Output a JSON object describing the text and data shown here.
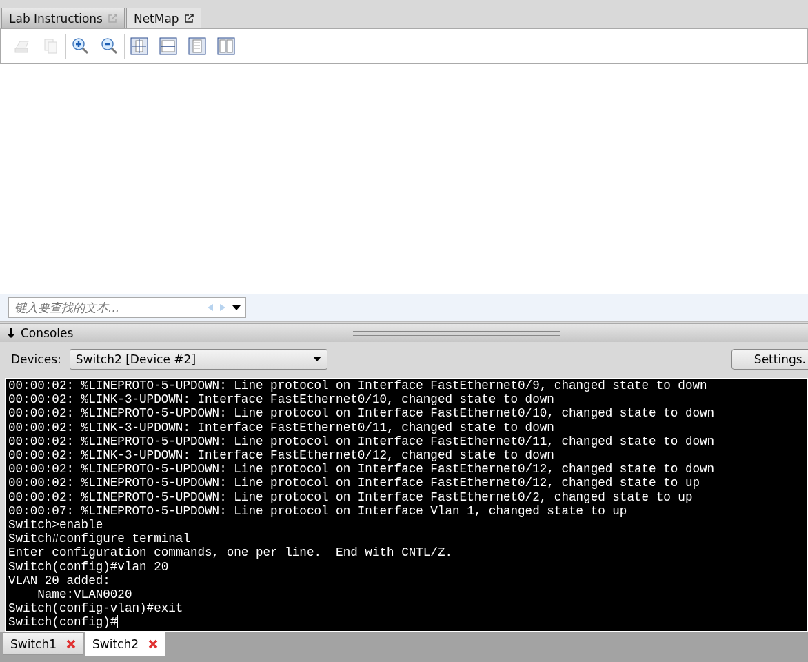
{
  "top_tabs": [
    {
      "label": "Lab Instructions",
      "selected": false
    },
    {
      "label": "NetMap",
      "selected": true
    }
  ],
  "toolbar": {
    "groups": [
      [
        {
          "kind": "print",
          "disabled": true
        },
        {
          "kind": "copy",
          "disabled": true
        }
      ],
      [
        {
          "kind": "zoom-in",
          "disabled": false
        },
        {
          "kind": "zoom-out",
          "disabled": false
        }
      ],
      [
        {
          "kind": "fit-page",
          "disabled": false
        },
        {
          "kind": "fit-width",
          "disabled": false
        },
        {
          "kind": "single-page",
          "disabled": false
        },
        {
          "kind": "two-page",
          "disabled": false
        }
      ]
    ]
  },
  "find": {
    "placeholder": "键入要查找的文本..."
  },
  "consoles": {
    "title": "Consoles",
    "devices_label": "Devices:",
    "device": "Switch2 [Device #2]",
    "settings_button": "Settings.",
    "lines": [
      "00:00:02: %LINEPROTO-5-UPDOWN: Line protocol on Interface FastEthernet0/9, changed state to down",
      "00:00:02: %LINK-3-UPDOWN: Interface FastEthernet0/10, changed state to down",
      "00:00:02: %LINEPROTO-5-UPDOWN: Line protocol on Interface FastEthernet0/10, changed state to down",
      "00:00:02: %LINK-3-UPDOWN: Interface FastEthernet0/11, changed state to down",
      "00:00:02: %LINEPROTO-5-UPDOWN: Line protocol on Interface FastEthernet0/11, changed state to down",
      "00:00:02: %LINK-3-UPDOWN: Interface FastEthernet0/12, changed state to down",
      "00:00:02: %LINEPROTO-5-UPDOWN: Line protocol on Interface FastEthernet0/12, changed state to down",
      "00:00:02: %LINEPROTO-5-UPDOWN: Line protocol on Interface FastEthernet0/12, changed state to up",
      "00:00:02: %LINEPROTO-5-UPDOWN: Line protocol on Interface FastEthernet0/2, changed state to up",
      "00:00:07: %LINEPROTO-5-UPDOWN: Line protocol on Interface Vlan 1, changed state to up",
      "Switch>enable",
      "Switch#configure terminal",
      "Enter configuration commands, one per line.  End with CNTL/Z.",
      "Switch(config)#vlan 20",
      "VLAN 20 added:",
      "    Name:VLAN0020",
      "Switch(config-vlan)#exit",
      "Switch(config)#"
    ]
  },
  "console_tabs": [
    {
      "label": "Switch1",
      "selected": false
    },
    {
      "label": "Switch2",
      "selected": true
    }
  ]
}
